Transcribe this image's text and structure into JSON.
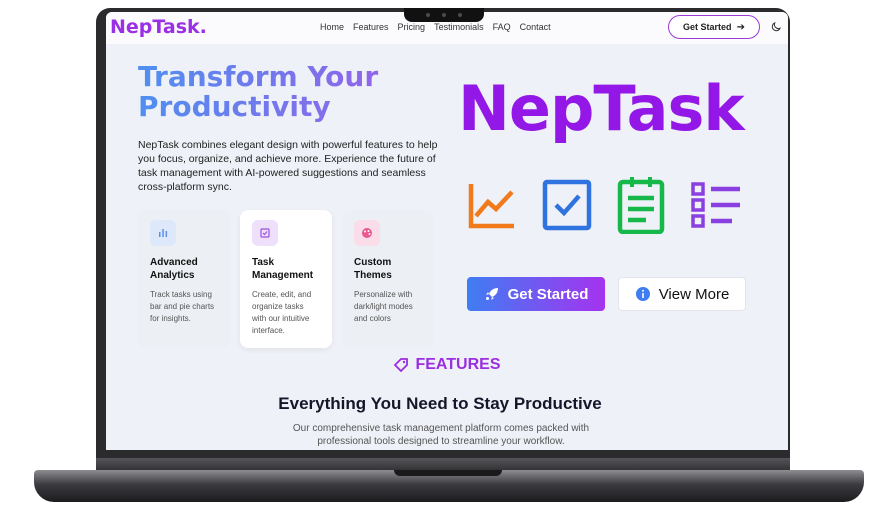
{
  "nav": {
    "brand": "NepTask.",
    "links": [
      "Home",
      "Features",
      "Pricing",
      "Testimonials",
      "FAQ",
      "Contact"
    ],
    "cta_label": "Get Started",
    "cta_icon": "arrow-right-icon",
    "theme_icon": "moon-icon"
  },
  "hero": {
    "title_line1": "Transform Your",
    "title_line2": "Productivity",
    "description": "NepTask combines elegant design with powerful features to help you focus, organize, and achieve more. Experience the future of task management with AI-powered suggestions and seamless cross-platform sync.",
    "brand_big": "NepTask",
    "feature_icons": [
      "chart-line-icon",
      "checkbox-icon",
      "clipboard-icon",
      "list-icon"
    ],
    "primary_button": "Get Started",
    "primary_icon": "rocket-icon",
    "secondary_button": "View More",
    "secondary_icon": "info-icon"
  },
  "cards": [
    {
      "title_1": "Advanced",
      "title_2": "Analytics",
      "text": "Track tasks using bar and pie charts for insights.",
      "icon": "bar-chart-icon"
    },
    {
      "title_1": "Task",
      "title_2": "Management",
      "text": "Create, edit, and organize tasks with our intuitive interface.",
      "icon": "check-square-icon"
    },
    {
      "title_1": "Custom",
      "title_2": "Themes",
      "text": "Personalize with dark/light modes and colors",
      "icon": "palette-icon"
    }
  ],
  "features": {
    "label": "FEATURES",
    "title": "Everything You Need to Stay Productive",
    "description": "Our comprehensive task management platform comes packed with professional tools designed to streamline your workflow."
  },
  "colors": {
    "brand_purple": "#9317e6",
    "gradient_blue": "#3f7df2",
    "gradient_purple": "#a533ef",
    "icon_orange": "#f07a1c",
    "icon_blue": "#2f73e0",
    "icon_green": "#16b84a",
    "icon_violet": "#8a3fe0"
  }
}
